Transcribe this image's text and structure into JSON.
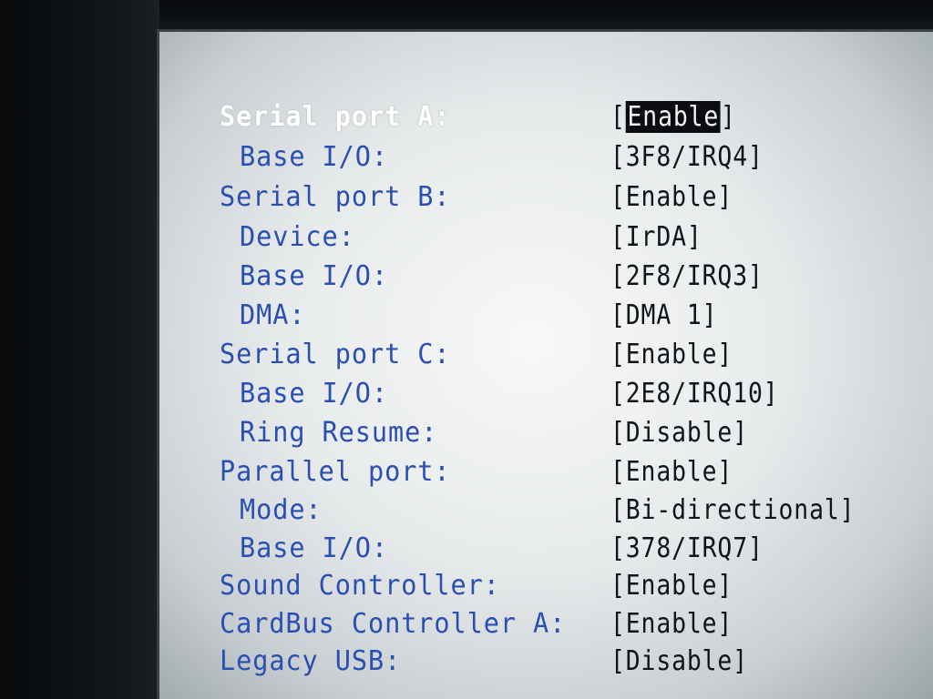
{
  "settings": [
    {
      "label": "Serial port A:",
      "value": "Enable",
      "level": "top",
      "selected": true
    },
    {
      "label": "Base I/O:",
      "value": "3F8/IRQ4",
      "level": "sub",
      "selected": false
    },
    {
      "label": "Serial port B:",
      "value": "Enable",
      "level": "top",
      "selected": false
    },
    {
      "label": "Device:",
      "value": "IrDA",
      "level": "sub",
      "selected": false
    },
    {
      "label": "Base I/O:",
      "value": "2F8/IRQ3",
      "level": "sub",
      "selected": false
    },
    {
      "label": "DMA:",
      "value": "DMA 1",
      "level": "sub",
      "selected": false
    },
    {
      "label": "Serial port C:",
      "value": "Enable",
      "level": "top",
      "selected": false
    },
    {
      "label": "Base I/O:",
      "value": "2E8/IRQ10",
      "level": "sub",
      "selected": false
    },
    {
      "label": "Ring Resume:",
      "value": "Disable",
      "level": "sub",
      "selected": false
    },
    {
      "label": "Parallel port:",
      "value": "Enable",
      "level": "top",
      "selected": false
    },
    {
      "label": "Mode:",
      "value": "Bi-directional",
      "level": "sub",
      "selected": false
    },
    {
      "label": "Base I/O:",
      "value": "378/IRQ7",
      "level": "sub",
      "selected": false
    },
    {
      "label": "Sound Controller:",
      "value": "Enable",
      "level": "top",
      "selected": false
    },
    {
      "label": "CardBus Controller A:",
      "value": "Enable",
      "level": "top",
      "selected": false
    },
    {
      "label": "Legacy USB:",
      "value": "Disable",
      "level": "top",
      "selected": false
    }
  ],
  "colors": {
    "label": "#2a4fb3",
    "selected_label": "#ffffff",
    "value": "#111418",
    "highlight_bg": "#0a0c10",
    "screen_bg": "#eef0f1"
  }
}
